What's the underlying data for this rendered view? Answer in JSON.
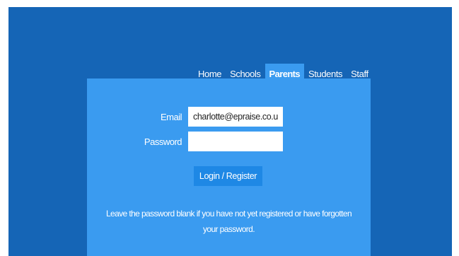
{
  "nav": {
    "items": [
      {
        "label": "Home"
      },
      {
        "label": "Schools"
      },
      {
        "label": "Parents"
      },
      {
        "label": "Students"
      },
      {
        "label": "Staff"
      }
    ],
    "active": "Parents"
  },
  "form": {
    "email_label": "Email",
    "email_value": "charlotte@epraise.co.uk",
    "password_label": "Password",
    "password_value": "",
    "submit_label": "Login / Register"
  },
  "help_text": "Leave the password blank if you have not yet registered or have forgotten your password.",
  "colors": {
    "background": "#1565b6",
    "panel": "#3a9bf0",
    "button": "#1e88e5",
    "active_tab": "#3a9bf0"
  }
}
